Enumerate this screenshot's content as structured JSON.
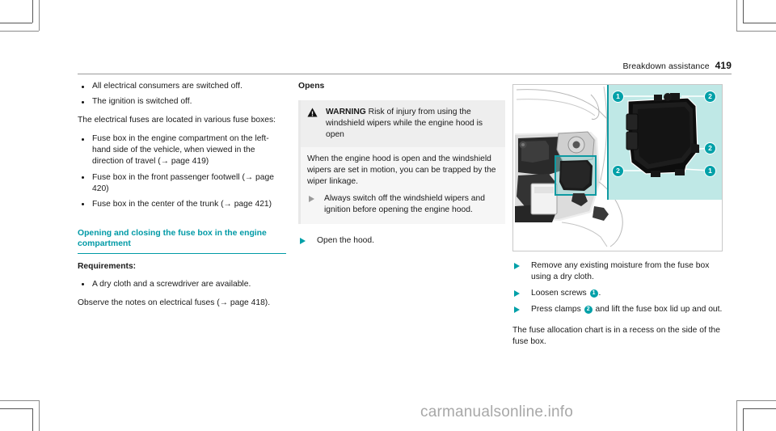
{
  "header": {
    "section_title": "Breakdown assistance",
    "page_number": "419"
  },
  "column_1": {
    "intro_bullets": [
      "All electrical consumers are switched off.",
      "The ignition is switched off."
    ],
    "para_fuses": "The electrical fuses are located in various fuse boxes:",
    "fusebox_bullets": [
      "Fuse box in the engine compartment on the left-hand side of the vehicle, when viewed in the direction of travel (→ page 419)",
      "Fuse box in the front passenger footwell (→ page 420)",
      "Fuse box in the center of the trunk (→ page 421)"
    ],
    "section_heading": "Opening and closing the fuse box in the engine compartment",
    "requirements_label": "Requirements:",
    "requirements_bullets": [
      "A dry cloth and a screwdriver are available."
    ],
    "observe_note": "Observe the notes on electrical fuses (→ page 418)."
  },
  "column_2": {
    "opens_label": "Opens",
    "warning": {
      "icon": "warning-triangle-icon",
      "tag": "WARNING",
      "title": "Risk of injury from using the windshield wipers while the engine hood is open",
      "body": "When the engine hood is open and the windshield wipers are set in motion, you can be trapped by the wiper linkage.",
      "actions": [
        "Always switch off the windshield wipers and ignition before opening the engine hood."
      ]
    },
    "actions": [
      "Open the hood."
    ]
  },
  "column_3": {
    "figure": {
      "alt": "Engine compartment fuse box location with detail view",
      "callouts": [
        {
          "id": "1",
          "position": "top-left"
        },
        {
          "id": "2",
          "position": "top-right"
        },
        {
          "id": "2",
          "position": "middle-right"
        },
        {
          "id": "2",
          "position": "bottom-left"
        },
        {
          "id": "1",
          "position": "bottom-right"
        }
      ]
    },
    "actions": [
      {
        "text_before": "Remove any existing moisture from the fuse box using a dry cloth.",
        "ref": null,
        "text_after": ""
      },
      {
        "text_before": "Loosen screws ",
        "ref": "1",
        "text_after": "."
      },
      {
        "text_before": "Press clamps ",
        "ref": "2",
        "text_after": " and lift the fuse box lid up and out."
      }
    ],
    "closing_note": "The fuse allocation chart is in a recess on the side of the fuse box."
  },
  "watermark": {
    "text": "carmanualsonline.info"
  },
  "colors": {
    "accent_teal": "#00a0a8",
    "heading_teal": "#009aa6",
    "panel_teal": "#bfe8e6",
    "warning_band": "#eeeeee",
    "warning_body": "#f6f6f6",
    "watermark_gray": "#a8a8a8"
  }
}
